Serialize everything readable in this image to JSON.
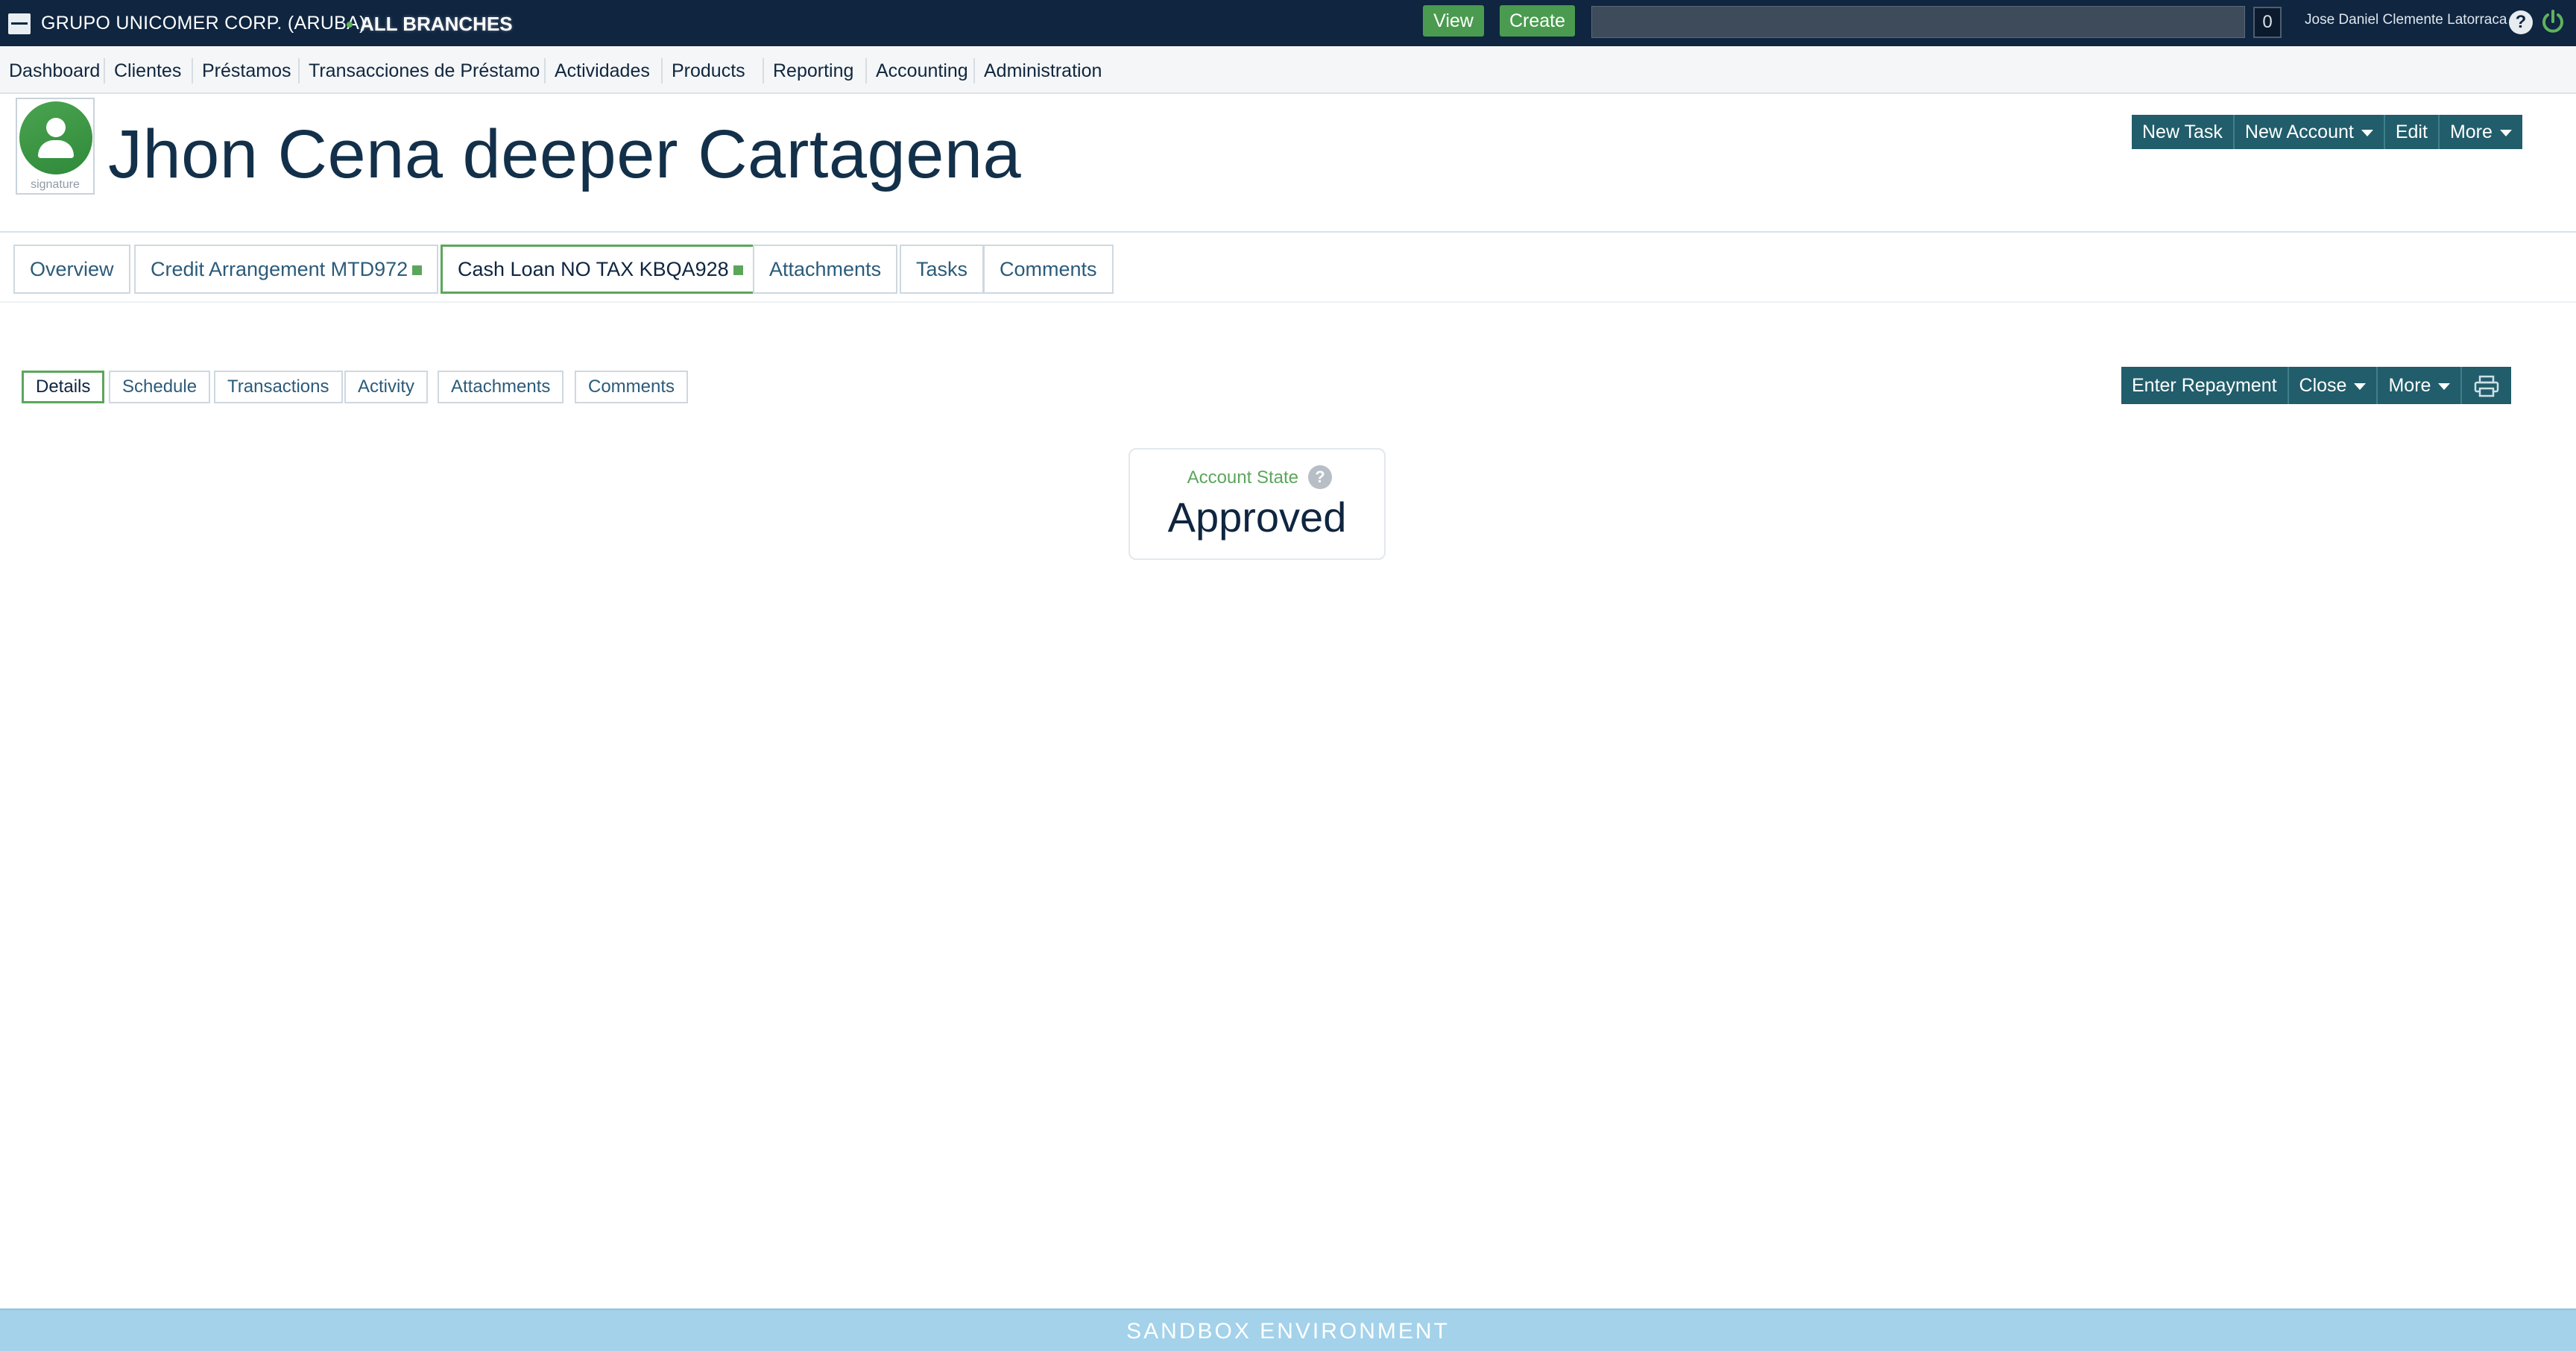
{
  "topbar": {
    "org": "GRUPO UNICOMER CORP. (ARUBA)",
    "branch": "ALL BRANCHES",
    "view_label": "View",
    "create_label": "Create",
    "search_placeholder": "",
    "counter": "0",
    "user": "Jose Daniel Clemente Latorraca"
  },
  "nav": {
    "items": [
      "Dashboard",
      "Clientes",
      "Préstamos",
      "Transacciones de Préstamo",
      "Actividades",
      "Products",
      "Reporting",
      "Accounting",
      "Administration"
    ]
  },
  "client": {
    "name": "Jhon Cena deeper Cartagena",
    "avatar_caption": "signature",
    "actions": {
      "new_task": "New Task",
      "new_account": "New Account",
      "edit": "Edit",
      "more": "More"
    }
  },
  "tabs": [
    {
      "label": "Overview"
    },
    {
      "label": "Credit Arrangement MTD972"
    },
    {
      "label": "Cash Loan NO TAX KBQA928"
    },
    {
      "label": "Attachments"
    },
    {
      "label": "Tasks"
    },
    {
      "label": "Comments"
    }
  ],
  "subtabs": [
    {
      "label": "Details"
    },
    {
      "label": "Schedule"
    },
    {
      "label": "Transactions"
    },
    {
      "label": "Activity"
    },
    {
      "label": "Attachments"
    },
    {
      "label": "Comments"
    }
  ],
  "loan_actions": {
    "enter_repayment": "Enter Repayment",
    "close": "Close",
    "more": "More"
  },
  "account_state": {
    "label": "Account State",
    "value": "Approved"
  },
  "footer": {
    "text": "SANDBOX ENVIRONMENT"
  },
  "colors": {
    "topbar_bg": "#0f2540",
    "accent_green": "#4a9b4f",
    "action_teal": "#215d6b",
    "footer_bg": "#a3d2ea"
  }
}
